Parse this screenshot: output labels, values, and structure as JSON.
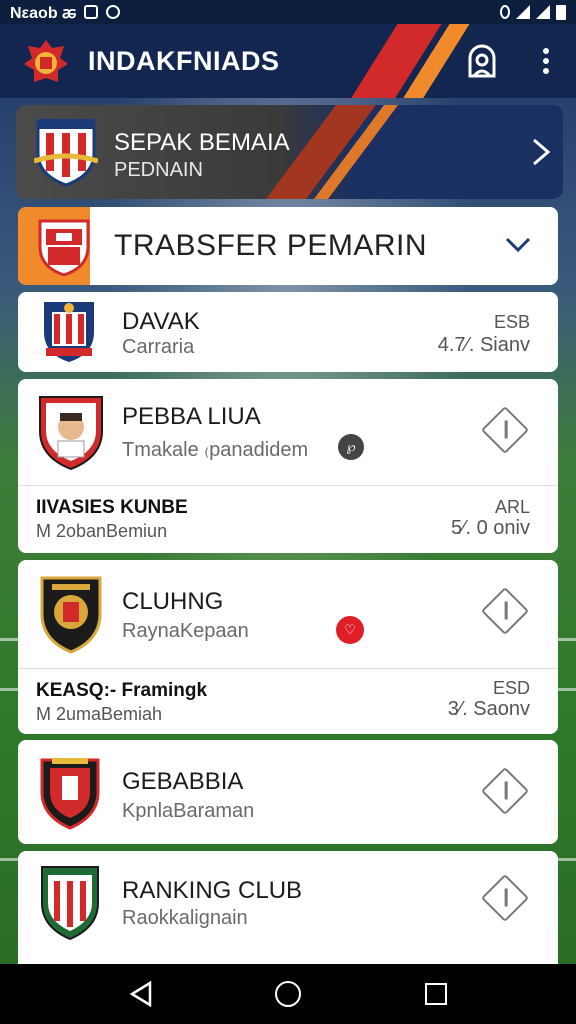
{
  "status_bar": {
    "carrier": "Nεaob ꬱ",
    "accent": "#0c1f3f"
  },
  "app_bar": {
    "title": "INDAKFNIADS",
    "background": "#12264f",
    "stripe_colors": [
      "#d22a2a",
      "#f08a2a"
    ]
  },
  "hero": {
    "title": "SEPAK BEMAIA",
    "subtitle": "PEDNAIN"
  },
  "transfer": {
    "label": "TRABSFER PEMARIN",
    "accent": "#f08a2a"
  },
  "cards": [
    {
      "name": "DAVAK",
      "subtitle": "Carraria",
      "stat_label": "ESB",
      "stat_value": "4.7⁄. Sianv"
    },
    {
      "name": "PEBBA LIUA",
      "subtitle": "Tmakale ₍panadidem",
      "badge": "℘",
      "row_title": "IIVASIES KUNBE",
      "row_sub": "M 2obanBemiun",
      "row_stat_label": "ARL",
      "row_stat_value": "5⁄. 0 oniv"
    },
    {
      "name": "CLUHNG",
      "subtitle": "RaynaKepaan",
      "badge": "♡",
      "row_title": "KEASQ:- Framingk",
      "row_sub": "M 2umaBemiah",
      "row_stat_label": "ESD",
      "row_stat_value": "3⁄. Saonv"
    },
    {
      "name": "GEBABBIA",
      "subtitle": "KpnlaBaraman"
    },
    {
      "name": "RANKING CLUB",
      "subtitle": "Raokkalignain"
    }
  ],
  "icons": {
    "account": "account-icon",
    "more": "more-vertical-icon",
    "chevron_right": "chevron-right-icon",
    "chevron_down": "chevron-down-icon",
    "action": "diamond-arrow-icon",
    "nav_back": "back-triangle-icon",
    "nav_home": "home-circle-icon",
    "nav_recent": "recent-square-icon"
  }
}
